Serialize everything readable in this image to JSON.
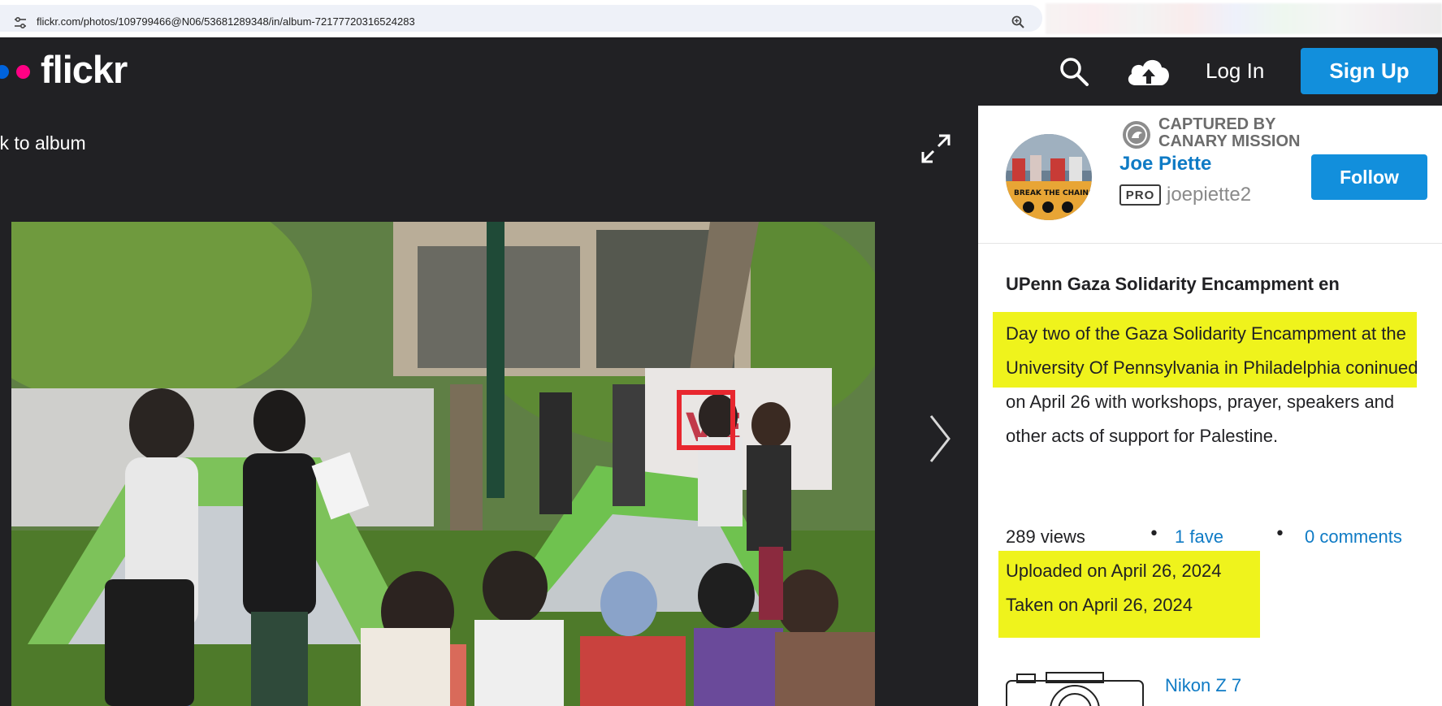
{
  "browser": {
    "url": "flickr.com/photos/109799466@N06/53681289348/in/album-72177720316524283"
  },
  "header": {
    "logo_text": "flickr",
    "login_label": "Log In",
    "signup_label": "Sign Up"
  },
  "photo_view": {
    "back_label": "ck to album"
  },
  "author": {
    "badge_line1": "CAPTURED BY",
    "badge_line2": "CANARY MISSION",
    "name": "Joe Piette",
    "pro_label": "PRO",
    "username": "joepiette2",
    "follow_label": "Follow"
  },
  "photo_info": {
    "title": "UPenn Gaza Solidarity Encampment en",
    "description": "Day two of the Gaza Solidarity Encampment at the University Of Pennsylvania in Philadelphia coninued on April 26 with workshops, prayer, speakers and other acts of support for Palestine.",
    "views": "289 views",
    "faves": "1 fave",
    "comments": "0 comments",
    "uploaded": "Uploaded on April 26, 2024",
    "taken": "Taken on April 26, 2024",
    "camera": "Nikon Z 7"
  },
  "colors": {
    "header_bg": "#212124",
    "accent_blue": "#128fdc",
    "link_blue": "#0f7bc5",
    "highlight_yellow": "#eff31c",
    "flickr_blue": "#0063dc",
    "flickr_pink": "#ff0084"
  }
}
